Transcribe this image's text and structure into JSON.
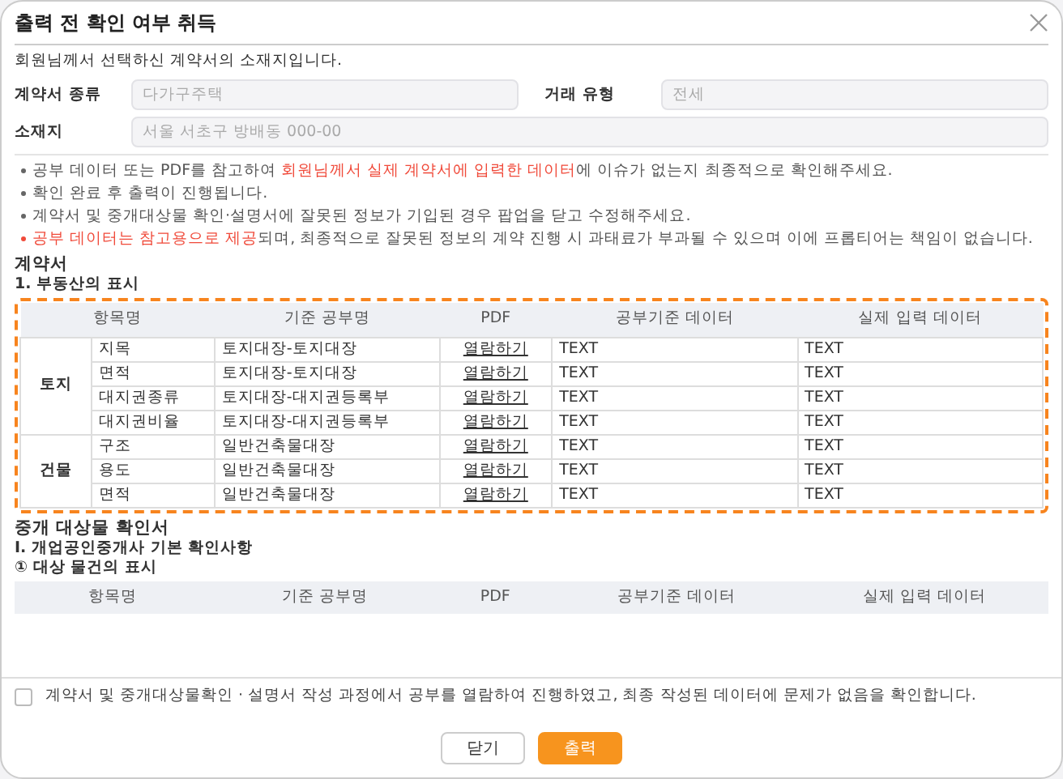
{
  "dialog": {
    "title": "출력 전 확인 여부 취득"
  },
  "intro": "회원님께서 선택하신 계약서의 소재지입니다.",
  "fields": [
    {
      "label": "계약서 종류",
      "placeholder": "다가구주택"
    },
    {
      "label": "거래 유형",
      "placeholder": "전세"
    },
    {
      "label": "소재지",
      "placeholder": "서울 서초구 방배동 000-00"
    }
  ],
  "notices": [
    {
      "highlight": false,
      "segments": [
        {
          "text": "공부 데이터 또는 PDF를 참고하여 ",
          "highlight": false
        },
        {
          "text": "회원님께서 실제 계약서에 입력한 데이터",
          "highlight": true
        },
        {
          "text": "에 이슈가 없는지 최종적으로 확인해주세요.",
          "highlight": false
        }
      ]
    },
    {
      "highlight": false,
      "segments": [
        {
          "text": "확인 완료 후 출력이 진행됩니다.",
          "highlight": false
        }
      ]
    },
    {
      "highlight": false,
      "segments": [
        {
          "text": "계약서 및 중개대상물 확인·설명서에 잘못된 정보가 기입된 경우 팝업을 닫고 수정해주세요.",
          "highlight": false
        }
      ]
    },
    {
      "highlight": true,
      "segments": [
        {
          "text": "공부 데이터는 참고용으로 제공",
          "highlight": true
        },
        {
          "text": "되며, 최종적으로 잘못된 정보의 계약 진행 시 과태료가 부과될 수 있으며 이에 프롭티어는 책임이 없습니다.",
          "highlight": false
        }
      ]
    }
  ],
  "sections": [
    {
      "title": "계약서",
      "subtitles": [
        "1. 부동산의 표시"
      ],
      "highlighted": true,
      "columns": [
        "항목명",
        "기준 공부명",
        "PDF",
        "공부기준 데이터",
        "실제 입력 데이터"
      ],
      "groups": [
        {
          "name": "토지",
          "rows": [
            {
              "item": "지목",
              "source": "토지대장-토지대장",
              "pdf": "열람하기",
              "official": "TEXT",
              "actual": "TEXT"
            },
            {
              "item": "면적",
              "source": "토지대장-토지대장",
              "pdf": "열람하기",
              "official": "TEXT",
              "actual": "TEXT"
            },
            {
              "item": "대지권종류",
              "source": "토지대장-대지권등록부",
              "pdf": "열람하기",
              "official": "TEXT",
              "actual": "TEXT"
            },
            {
              "item": "대지권비율",
              "source": "토지대장-대지권등록부",
              "pdf": "열람하기",
              "official": "TEXT",
              "actual": "TEXT"
            }
          ]
        },
        {
          "name": "건물",
          "rows": [
            {
              "item": "구조",
              "source": "일반건축물대장",
              "pdf": "열람하기",
              "official": "TEXT",
              "actual": "TEXT"
            },
            {
              "item": "용도",
              "source": "일반건축물대장",
              "pdf": "열람하기",
              "official": "TEXT",
              "actual": "TEXT"
            },
            {
              "item": "면적",
              "source": "일반건축물대장",
              "pdf": "열람하기",
              "official": "TEXT",
              "actual": "TEXT"
            }
          ]
        }
      ]
    },
    {
      "title": "중개 대상물 확인서",
      "subtitles": [
        "I. 개업공인중개사 기본 확인사항",
        "① 대상 물건의 표시"
      ],
      "highlighted": false,
      "columns": [
        "항목명",
        "기준 공부명",
        "PDF",
        "공부기준 데이터",
        "실제 입력 데이터"
      ]
    }
  ],
  "confirm": {
    "label": "계약서 및 중개대상물확인 · 설명서 작성 과정에서 공부를 열람하여 진행하였고, 최종 작성된 데이터에 문제가 없음을 확인합니다.",
    "checked": false
  },
  "buttons": [
    {
      "label": "닫기",
      "kind": "secondary"
    },
    {
      "label": "출력",
      "kind": "primary"
    }
  ]
}
